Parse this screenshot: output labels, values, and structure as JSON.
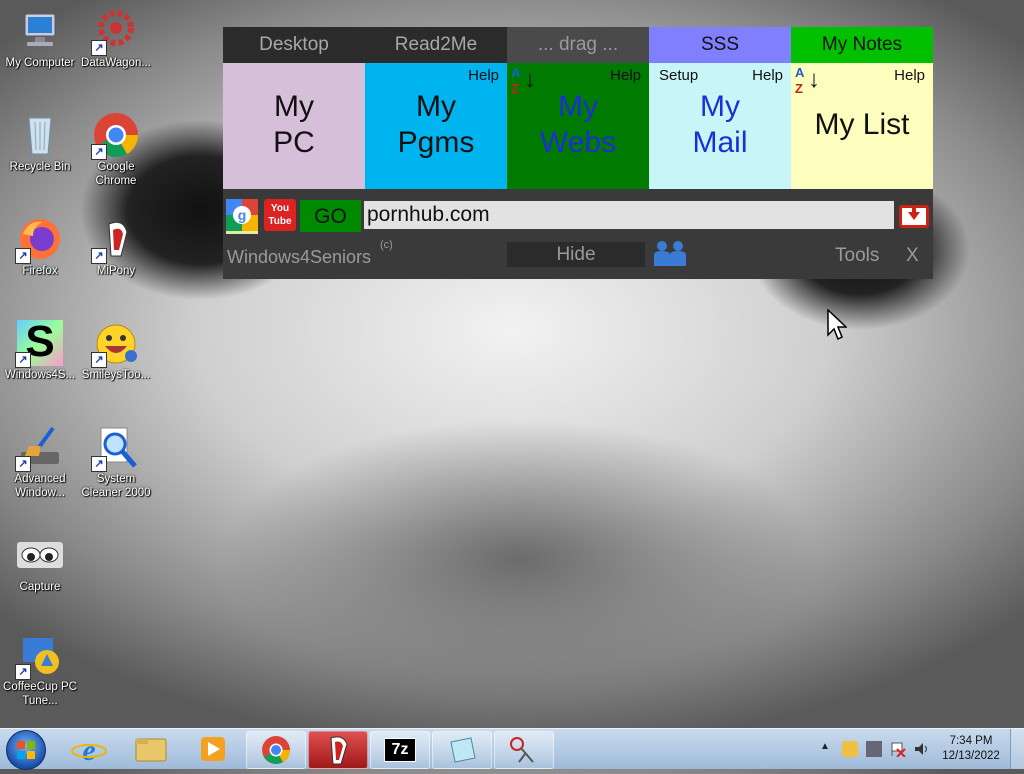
{
  "desktop_icons": [
    {
      "label": "My Computer",
      "icon": "computer-icon"
    },
    {
      "label": "DataWagon...",
      "icon": "gear-red-icon"
    },
    {
      "label": "Recycle Bin",
      "icon": "recycle-bin-icon"
    },
    {
      "label": "Google Chrome",
      "icon": "chrome-icon"
    },
    {
      "label": "Firefox",
      "icon": "firefox-icon"
    },
    {
      "label": "MiPony",
      "icon": "mipony-icon"
    },
    {
      "label": "Windows4S...",
      "icon": "windows4seniors-icon"
    },
    {
      "label": "SmileysToo...",
      "icon": "smiley-icon"
    },
    {
      "label": "Advanced Window...",
      "icon": "broom-icon"
    },
    {
      "label": "System Cleaner 2000",
      "icon": "magnifier-icon"
    },
    {
      "label": "Capture",
      "icon": "capture-eyes-icon"
    },
    {
      "label": "CoffeeCup PC Tune...",
      "icon": "coffeecup-icon"
    }
  ],
  "panel": {
    "tabs": [
      "Desktop",
      "Read2Me",
      "... drag ...",
      "SSS",
      "My Notes"
    ],
    "tiles": [
      {
        "line1": "My",
        "line2": "PC",
        "help": "",
        "setup": "",
        "bg": "#d6bfd8",
        "color": "#111111"
      },
      {
        "line1": "My",
        "line2": "Pgms",
        "help": "Help",
        "setup": "",
        "bg": "#00b4f0",
        "color": "#111111"
      },
      {
        "line1": "My",
        "line2": "Webs",
        "help": "Help",
        "setup": "",
        "bg": "#007a00",
        "color": "#1a2fd6"
      },
      {
        "line1": "My",
        "line2": "Mail",
        "help": "Help",
        "setup": "Setup",
        "bg": "#c8f6f8",
        "color": "#1a2fd6"
      },
      {
        "line1": "My List",
        "line2": "",
        "help": "Help",
        "setup": "",
        "bg": "#fdfdbe",
        "color": "#111111"
      }
    ],
    "az_a": "A",
    "az_z": "Z",
    "go_label": "GO",
    "url_value": "pornhub.com",
    "brand": "Windows4Seniors",
    "copyright": "(c)",
    "hide_label": "Hide",
    "tools_label": "Tools",
    "close_label": "X",
    "youtube_text": "You Tube"
  },
  "taskbar": {
    "time": "7:34 PM",
    "date": "12/13/2022",
    "sevenzip": "7z"
  },
  "colors": {
    "panel_bg": "#3a3a3a",
    "sss_tab": "#8080ff",
    "notes_tab": "#00c000",
    "go_bg": "#008a00"
  }
}
